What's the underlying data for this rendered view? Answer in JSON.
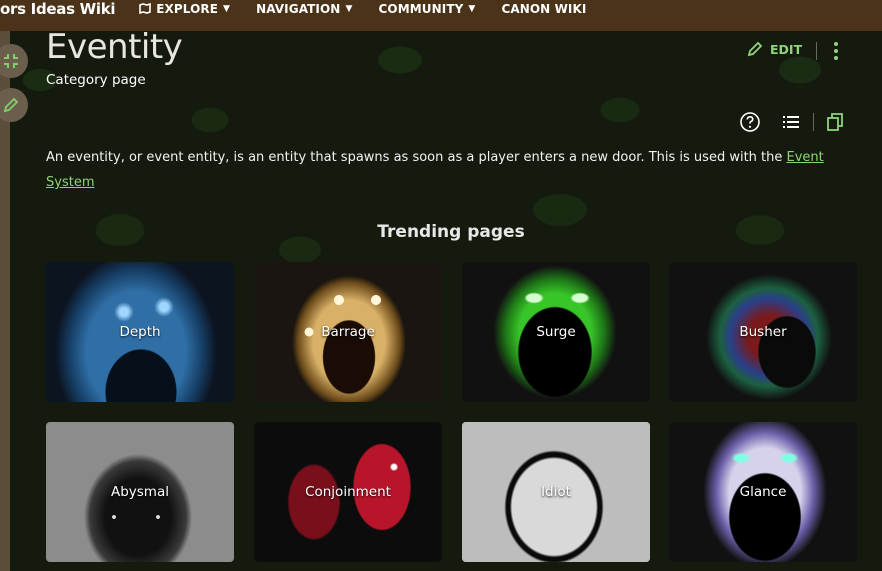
{
  "topnav": {
    "wiki_name": "oors Ideas Wiki",
    "items": [
      {
        "label": "EXPLORE"
      },
      {
        "label": "NAVIGATION"
      },
      {
        "label": "COMMUNITY"
      },
      {
        "label": "CANON WIKI"
      }
    ]
  },
  "page": {
    "title": "Eventity",
    "subtitle": "Category page",
    "edit_label": "EDIT",
    "description_text": "An eventity, or event entity, is an entity that spawns as soon as a player enters a new door. This is used with the ",
    "description_link": "Event System"
  },
  "trending": {
    "title": "Trending pages",
    "cards": [
      {
        "label": "Depth"
      },
      {
        "label": "Barrage"
      },
      {
        "label": "Surge"
      },
      {
        "label": "Busher"
      },
      {
        "label": "Abysmal"
      },
      {
        "label": "Conjoinment"
      },
      {
        "label": "Idiot"
      },
      {
        "label": "Glance"
      }
    ]
  },
  "colors": {
    "nav_bg": "#4a3318",
    "accent": "#8fd37a",
    "text": "#f2f2f2"
  },
  "icons": {
    "explore": "map-icon",
    "edit": "pencil-icon",
    "more": "vertical-dots-icon",
    "help": "question-circle-icon",
    "toc": "list-icon",
    "copy": "copy-icon",
    "collapse": "collapse-icon"
  }
}
